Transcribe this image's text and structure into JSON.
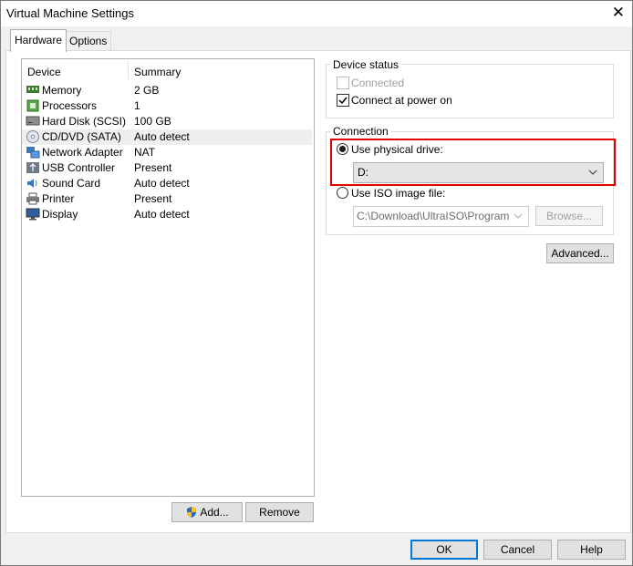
{
  "window": {
    "title": "Virtual Machine Settings",
    "close_glyph": "✕"
  },
  "tabs": [
    {
      "label": "Hardware"
    },
    {
      "label": "Options"
    }
  ],
  "device_list": {
    "columns": {
      "device": "Device",
      "summary": "Summary"
    },
    "rows": [
      {
        "device": "Memory",
        "summary": "2 GB",
        "icon": "memory-icon"
      },
      {
        "device": "Processors",
        "summary": "1",
        "icon": "processor-icon"
      },
      {
        "device": "Hard Disk (SCSI)",
        "summary": "100 GB",
        "icon": "hard-disk-icon"
      },
      {
        "device": "CD/DVD (SATA)",
        "summary": "Auto detect",
        "icon": "cd-dvd-icon",
        "selected": true
      },
      {
        "device": "Network Adapter",
        "summary": "NAT",
        "icon": "network-adapter-icon"
      },
      {
        "device": "USB Controller",
        "summary": "Present",
        "icon": "usb-icon"
      },
      {
        "device": "Sound Card",
        "summary": "Auto detect",
        "icon": "sound-card-icon"
      },
      {
        "device": "Printer",
        "summary": "Present",
        "icon": "printer-icon"
      },
      {
        "device": "Display",
        "summary": "Auto detect",
        "icon": "display-icon"
      }
    ]
  },
  "list_buttons": {
    "add": "Add...",
    "remove": "Remove"
  },
  "device_status": {
    "legend": "Device status",
    "connected": {
      "label": "Connected",
      "checked": false,
      "enabled": false
    },
    "connect_at_power_on": {
      "label": "Connect at power on",
      "checked": true,
      "enabled": true
    }
  },
  "connection": {
    "legend": "Connection",
    "physical": {
      "label": "Use physical drive:",
      "selected": true,
      "drive": "D:"
    },
    "iso": {
      "label": "Use ISO image file:",
      "selected": false,
      "path": "C:\\Download\\UltraISO\\Program",
      "browse": "Browse..."
    }
  },
  "advanced_button": "Advanced...",
  "dialog_buttons": {
    "ok": "OK",
    "cancel": "Cancel",
    "help": "Help"
  },
  "colors": {
    "highlight_border": "#e00000",
    "default_button_border": "#0078d7",
    "selected_row": "#efefef"
  }
}
